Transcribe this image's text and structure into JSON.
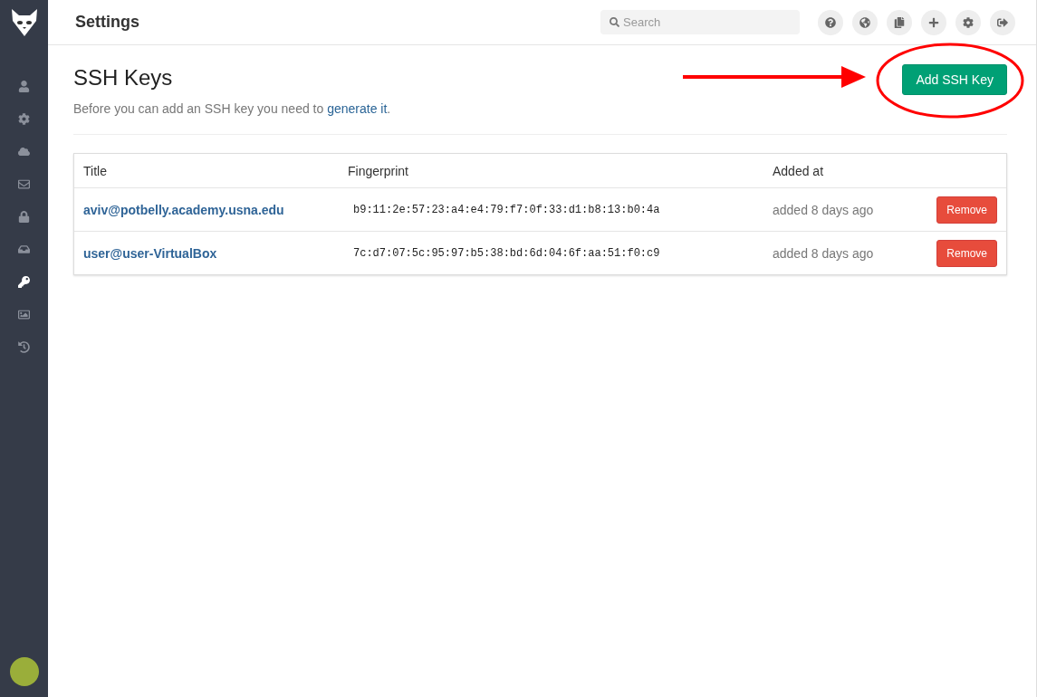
{
  "header": {
    "title": "Settings",
    "search": {
      "placeholder": "Search"
    },
    "actions": [
      {
        "kind": "help"
      },
      {
        "kind": "globe"
      },
      {
        "kind": "copy"
      },
      {
        "kind": "plus"
      },
      {
        "kind": "gear"
      },
      {
        "kind": "logout"
      }
    ]
  },
  "sidebar": {
    "items": [
      {
        "kind": "user",
        "selected": false
      },
      {
        "kind": "gear",
        "selected": false
      },
      {
        "kind": "cloud",
        "selected": false
      },
      {
        "kind": "mail",
        "selected": false
      },
      {
        "kind": "lock",
        "selected": false
      },
      {
        "kind": "inbox",
        "selected": false
      },
      {
        "kind": "key",
        "selected": true
      },
      {
        "kind": "image",
        "selected": false
      },
      {
        "kind": "history",
        "selected": false
      }
    ]
  },
  "page": {
    "title": "SSH Keys",
    "intro": {
      "before": "Before you can add an SSH key you need to",
      "link": "generate it",
      "after": "."
    },
    "add_button": "Add SSH Key"
  },
  "table": {
    "columns": [
      "Title",
      "Fingerprint",
      "Added at"
    ],
    "rows": [
      {
        "title": "aviv@potbelly.academy.usna.edu",
        "fingerprint": "b9:11:2e:57:23:a4:e4:79:f7:0f:33:d1:b8:13:b0:4a",
        "added": "added 8 days ago",
        "action": "Remove"
      },
      {
        "title": "user@user-VirtualBox",
        "fingerprint": "7c:d7:07:5c:95:97:b5:38:bd:6d:04:6f:aa:51:f0:c9",
        "added": "added 8 days ago",
        "action": "Remove"
      }
    ]
  }
}
